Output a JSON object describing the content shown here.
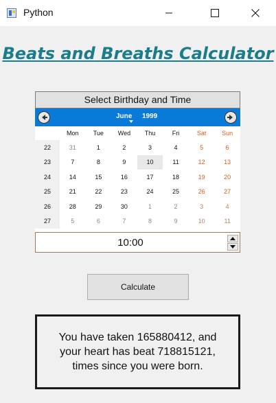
{
  "window": {
    "title": "Python",
    "minimize_icon": "minimize-icon",
    "maximize_icon": "maximize-icon",
    "close_icon": "close-icon"
  },
  "app_title": "Beats and Breaths Calculator",
  "calendar": {
    "header": "Select Birthday and Time",
    "month": "June",
    "year": "1999",
    "prev_icon": "arrow-left-icon",
    "next_icon": "arrow-right-icon",
    "weekdays": [
      "Mon",
      "Tue",
      "Wed",
      "Thu",
      "Fri",
      "Sat",
      "Sun"
    ],
    "weekend_color": "#d4601a",
    "nav_color": "#0a7ad8",
    "weeks": [
      {
        "num": "22",
        "days": [
          "31",
          "1",
          "2",
          "3",
          "4",
          "5",
          "6"
        ]
      },
      {
        "num": "23",
        "days": [
          "7",
          "8",
          "9",
          "10",
          "11",
          "12",
          "13"
        ]
      },
      {
        "num": "24",
        "days": [
          "14",
          "15",
          "16",
          "17",
          "18",
          "19",
          "20"
        ]
      },
      {
        "num": "25",
        "days": [
          "21",
          "22",
          "23",
          "24",
          "25",
          "26",
          "27"
        ]
      },
      {
        "num": "26",
        "days": [
          "28",
          "29",
          "30",
          "1",
          "2",
          "3",
          "4"
        ]
      },
      {
        "num": "27",
        "days": [
          "5",
          "6",
          "7",
          "8",
          "9",
          "10",
          "11"
        ]
      }
    ]
  },
  "time": {
    "value": "10:00",
    "up_icon": "spin-up-icon",
    "down_icon": "spin-down-icon"
  },
  "calculate_label": "Calculate",
  "result": {
    "lines": [
      "You have taken 165880412, and",
      "your heart has beat 718815121,",
      "times since you were born."
    ]
  }
}
